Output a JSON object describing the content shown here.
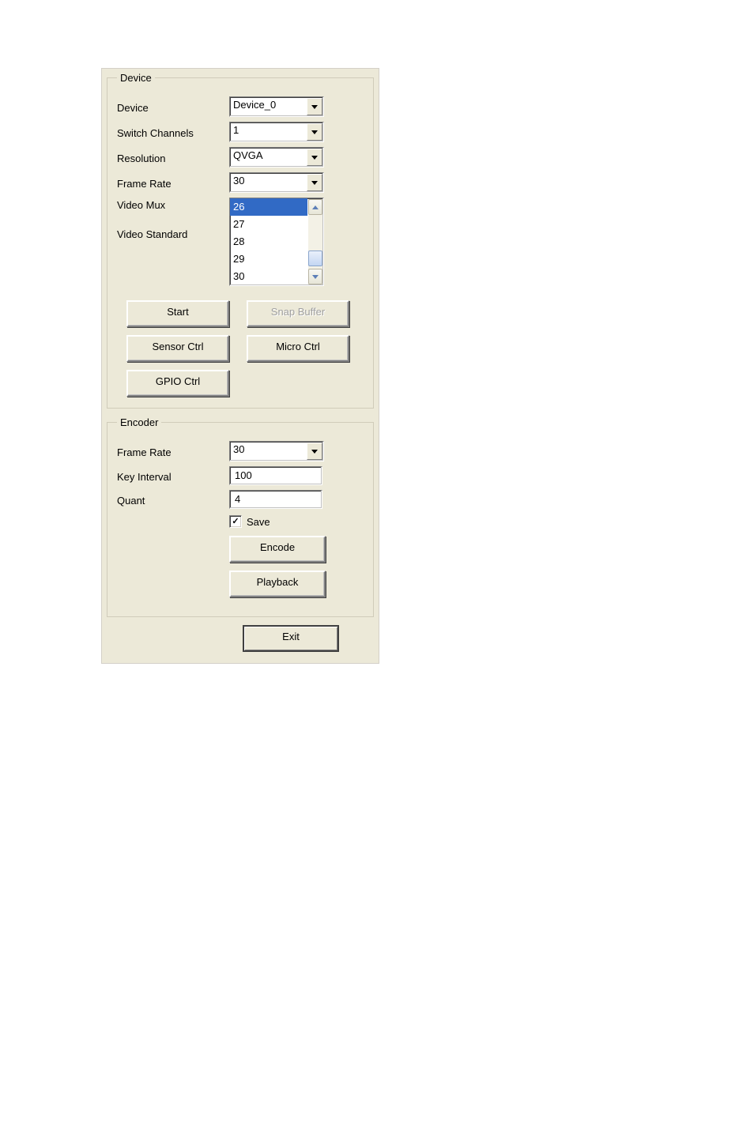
{
  "device": {
    "legend": "Device",
    "fields": {
      "device": {
        "label": "Device",
        "value": "Device_0"
      },
      "switch_channels": {
        "label": "Switch Channels",
        "value": "1"
      },
      "resolution": {
        "label": "Resolution",
        "value": "QVGA"
      },
      "frame_rate": {
        "label": "Frame Rate",
        "value": "30"
      },
      "video_mux": {
        "label": "Video Mux"
      },
      "video_standard": {
        "label": "Video Standard"
      }
    },
    "listbox": {
      "items": [
        "26",
        "27",
        "28",
        "29",
        "30"
      ],
      "selected_index": 0
    },
    "buttons": {
      "start": "Start",
      "snap_buffer": "Snap Buffer",
      "sensor_ctrl": "Sensor Ctrl",
      "micro_ctrl": "Micro Ctrl",
      "gpio_ctrl": "GPIO Ctrl"
    }
  },
  "encoder": {
    "legend": "Encoder",
    "fields": {
      "frame_rate": {
        "label": "Frame Rate",
        "value": "30"
      },
      "key_interval": {
        "label": "Key Interval",
        "value": "100"
      },
      "quant": {
        "label": "Quant",
        "value": "4"
      }
    },
    "save": {
      "label": "Save",
      "checked": true
    },
    "buttons": {
      "encode": "Encode",
      "playback": "Playback"
    }
  },
  "exit": "Exit"
}
